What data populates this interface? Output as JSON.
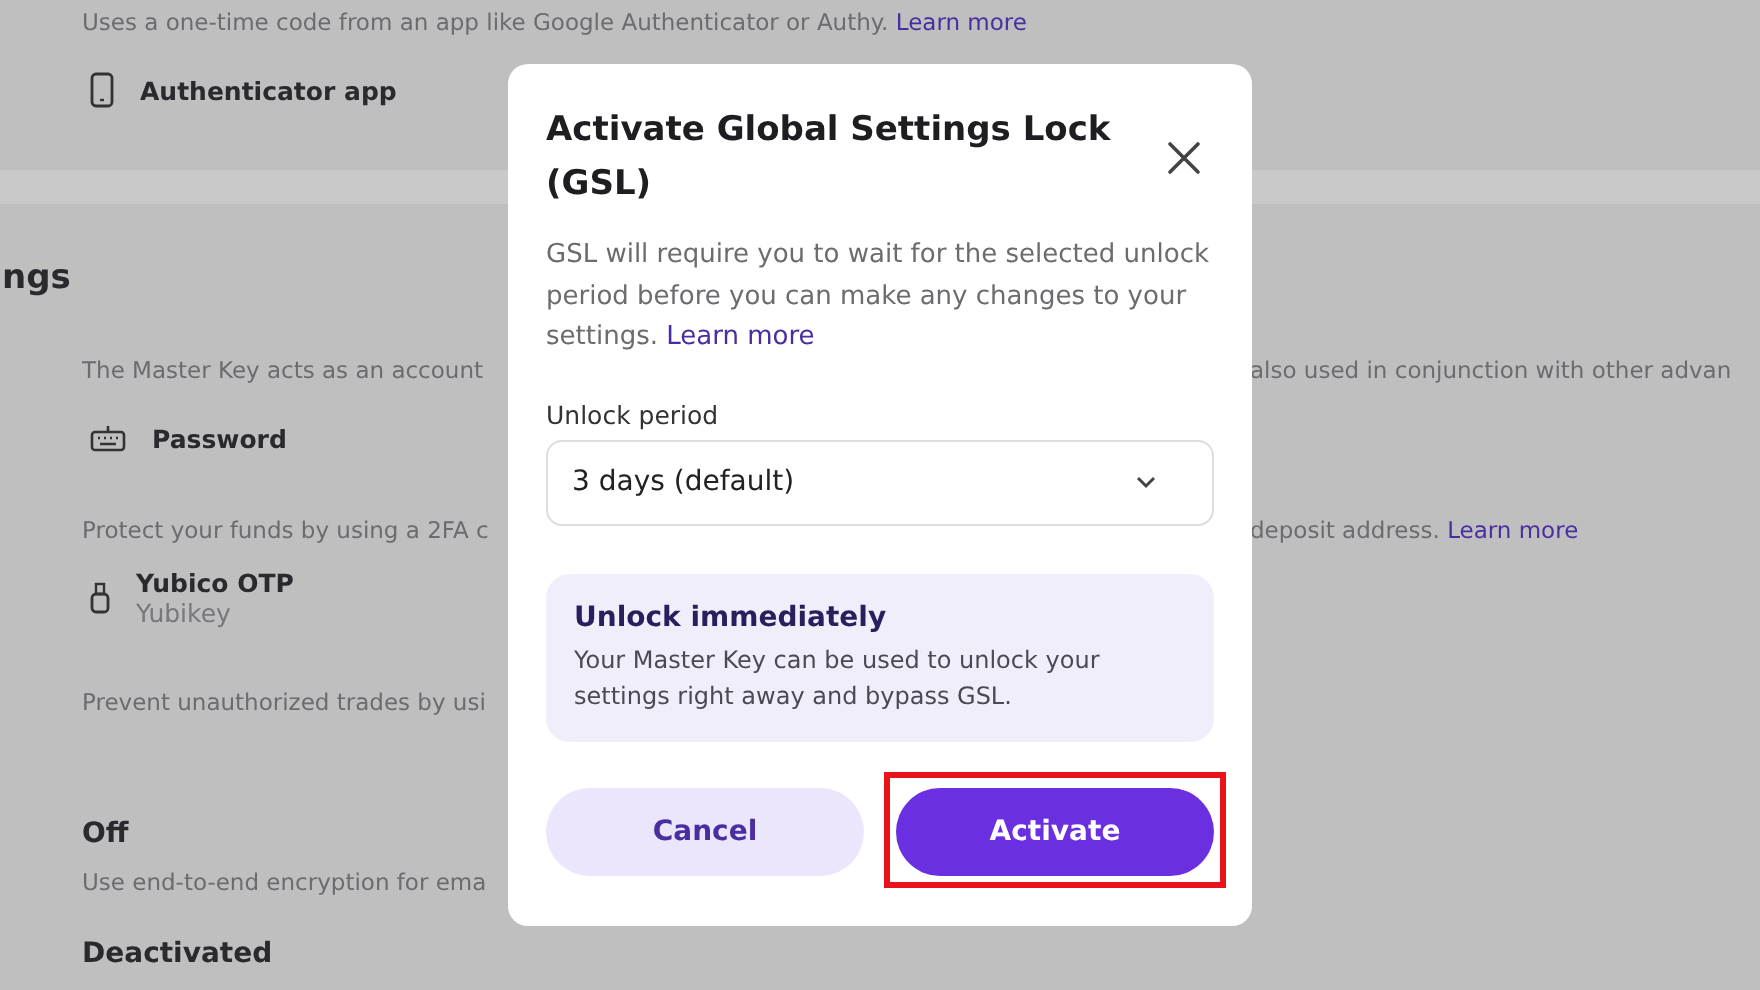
{
  "page": {
    "sections": [
      {
        "rows": [
          {
            "kind": "desc",
            "text": "Uses a one-time code from an app like Google Authenticator or Authy.",
            "link": "Learn more"
          },
          {
            "kind": "item",
            "label": "Authenticator app"
          }
        ]
      },
      {
        "rows": [
          {
            "kind": "heading",
            "text": "ngs"
          }
        ]
      },
      {
        "rows": [
          {
            "kind": "desc",
            "text": "The Master Key acts as an account",
            "right": "also used in conjunction with other advan"
          },
          {
            "kind": "item",
            "label": "Password"
          }
        ]
      },
      {
        "rows": [
          {
            "kind": "desc",
            "text": "Protect your funds by using a 2FA c",
            "right": "deposit address.",
            "link": "Learn more"
          },
          {
            "kind": "item",
            "label": "Yubico OTP",
            "sublabel": "Yubikey"
          }
        ]
      },
      {
        "rows": [
          {
            "kind": "desc",
            "text": "Prevent unauthorized trades by usi"
          }
        ]
      },
      {
        "rows": [
          {
            "kind": "status",
            "text": "Off"
          },
          {
            "kind": "desc",
            "text": "Use end-to-end encryption for ema"
          }
        ]
      },
      {
        "rows": [
          {
            "kind": "status",
            "text": "Deactivated"
          }
        ]
      }
    ]
  },
  "dialog": {
    "title": "Activate Global Settings Lock (GSL)",
    "body": "GSL will require you to wait for the selected unlock period before you can make any changes to your settings.",
    "link": "Learn more",
    "field": {
      "label": "Unlock period",
      "value": "3 days (default)"
    },
    "info": {
      "title": "Unlock immediately",
      "body": "Your Master Key can be used to unlock your settings right away and bypass GSL."
    },
    "buttons": [
      {
        "label": "Cancel",
        "kind": "secondary",
        "highlighted": false
      },
      {
        "label": "Activate",
        "kind": "primary",
        "highlighted": true
      }
    ]
  }
}
